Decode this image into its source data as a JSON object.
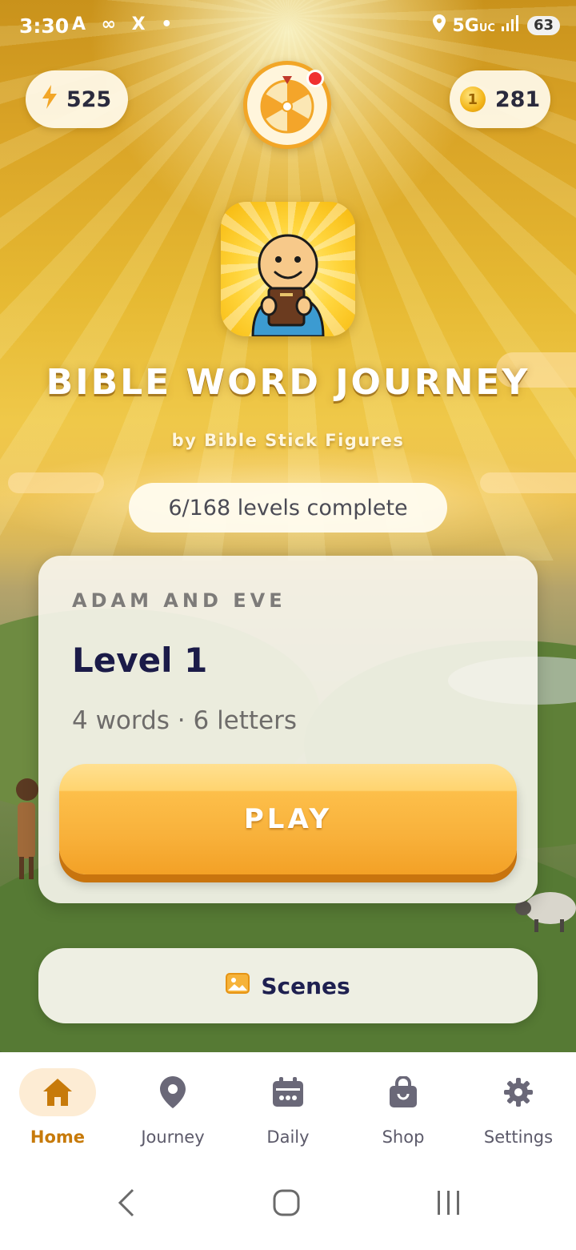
{
  "status_bar": {
    "time": "3:30",
    "left_icons": "A ∞ X •",
    "network": "5G",
    "network_sub": "UC",
    "battery": "63"
  },
  "top_bar": {
    "energy": "525",
    "coins": "281",
    "wheel_has_notification": true
  },
  "app": {
    "title": "BIBLE WORD JOURNEY",
    "subtitle": "by Bible Stick Figures"
  },
  "progress": {
    "text": "6/168 levels complete"
  },
  "level_card": {
    "chapter": "ADAM AND EVE",
    "title": "Level 1",
    "meta": "4 words · 6 letters",
    "play_label": "PLAY"
  },
  "scenes": {
    "label": "Scenes",
    "icon": "image-icon"
  },
  "bottom_nav": {
    "items": [
      {
        "label": "Home",
        "icon": "home-icon",
        "active": true
      },
      {
        "label": "Journey",
        "icon": "location-pin-icon",
        "active": false
      },
      {
        "label": "Daily",
        "icon": "calendar-icon",
        "active": false
      },
      {
        "label": "Shop",
        "icon": "shopping-bag-icon",
        "active": false
      },
      {
        "label": "Settings",
        "icon": "gear-icon",
        "active": false
      }
    ]
  },
  "colors": {
    "accent": "#f3a126",
    "nav_active": "#c77a0a",
    "title_dark": "#1b1b48"
  }
}
